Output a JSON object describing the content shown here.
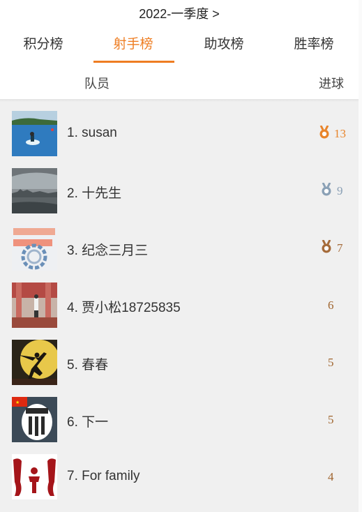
{
  "header": {
    "season": "2022-一季度 >",
    "tabs": [
      {
        "label": "积分榜",
        "active": false
      },
      {
        "label": "射手榜",
        "active": true
      },
      {
        "label": "助攻榜",
        "active": false
      },
      {
        "label": "胜率榜",
        "active": false
      }
    ],
    "columns": {
      "player": "队员",
      "goals": "进球"
    }
  },
  "colors": {
    "accent": "#ee7d22",
    "gold": "#e8842a",
    "silver": "#8aa0b5",
    "bronze": "#a56b3a",
    "goals_text": "#a0652f"
  },
  "players": [
    {
      "rank_name": "1. susan",
      "goals": "13",
      "medal": "gold",
      "avatar_icon": "jetski-photo"
    },
    {
      "rank_name": "2. 十先生",
      "goals": "9",
      "medal": "silver",
      "avatar_icon": "city-skyline-photo"
    },
    {
      "rank_name": "3. 纪念三月三",
      "goals": "7",
      "medal": "bronze",
      "avatar_icon": "chain-text-photo"
    },
    {
      "rank_name": "4. 贾小松18725835",
      "goals": "6",
      "medal": "",
      "avatar_icon": "building-person-photo"
    },
    {
      "rank_name": "5. 春春",
      "goals": "5",
      "medal": "",
      "avatar_icon": "kick-silhouette-photo"
    },
    {
      "rank_name": "6. 下一",
      "goals": "5",
      "medal": "",
      "avatar_icon": "juventus-flag-photo"
    },
    {
      "rank_name": "7. For family",
      "goals": "4",
      "medal": "",
      "avatar_icon": "family-figures-photo"
    }
  ]
}
